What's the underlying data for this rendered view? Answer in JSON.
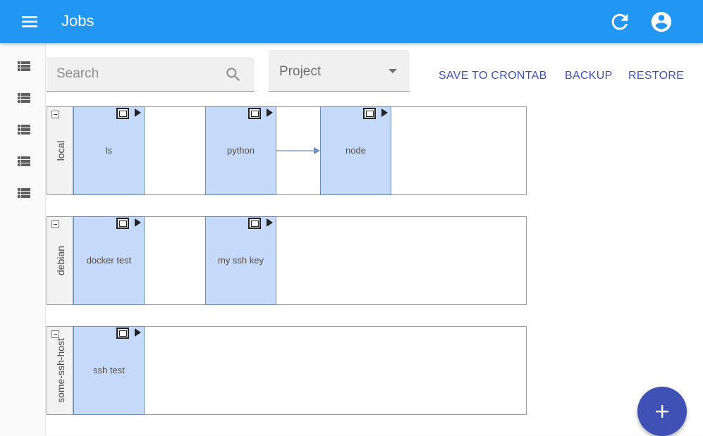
{
  "appbar": {
    "title": "Jobs",
    "color": "#2196f3",
    "icons": {
      "menu": "menu-icon",
      "refresh": "refresh-icon",
      "account": "account-circle-icon"
    }
  },
  "sidebar": {
    "items": [
      {
        "icon": "list-icon"
      },
      {
        "icon": "list-icon"
      },
      {
        "icon": "list-icon"
      },
      {
        "icon": "list-icon"
      },
      {
        "icon": "list-icon"
      }
    ]
  },
  "toolbar": {
    "search_placeholder": "Search",
    "search_value": "",
    "project_label": "Project",
    "save_to_crontab_label": "SAVE TO CRONTAB",
    "backup_label": "BACKUP",
    "restore_label": "RESTORE",
    "accent_color": "#3f51b5"
  },
  "hosts": [
    {
      "name": "local",
      "jobs": [
        {
          "name": "ls"
        },
        {
          "name": "python"
        },
        {
          "name": "node"
        }
      ],
      "edges": [
        {
          "from": "python",
          "to": "node"
        }
      ]
    },
    {
      "name": "debian",
      "jobs": [
        {
          "name": "docker test"
        },
        {
          "name": "my ssh key"
        }
      ]
    },
    {
      "name": "some-ssh-host",
      "jobs": [
        {
          "name": "ssh test"
        }
      ]
    }
  ],
  "colors": {
    "job_fill": "#c5dafa",
    "job_border": "#6c8ebf",
    "edge": "#6c8ebf",
    "fab": "#3f51b5"
  },
  "fab": {
    "icon": "plus-icon"
  }
}
